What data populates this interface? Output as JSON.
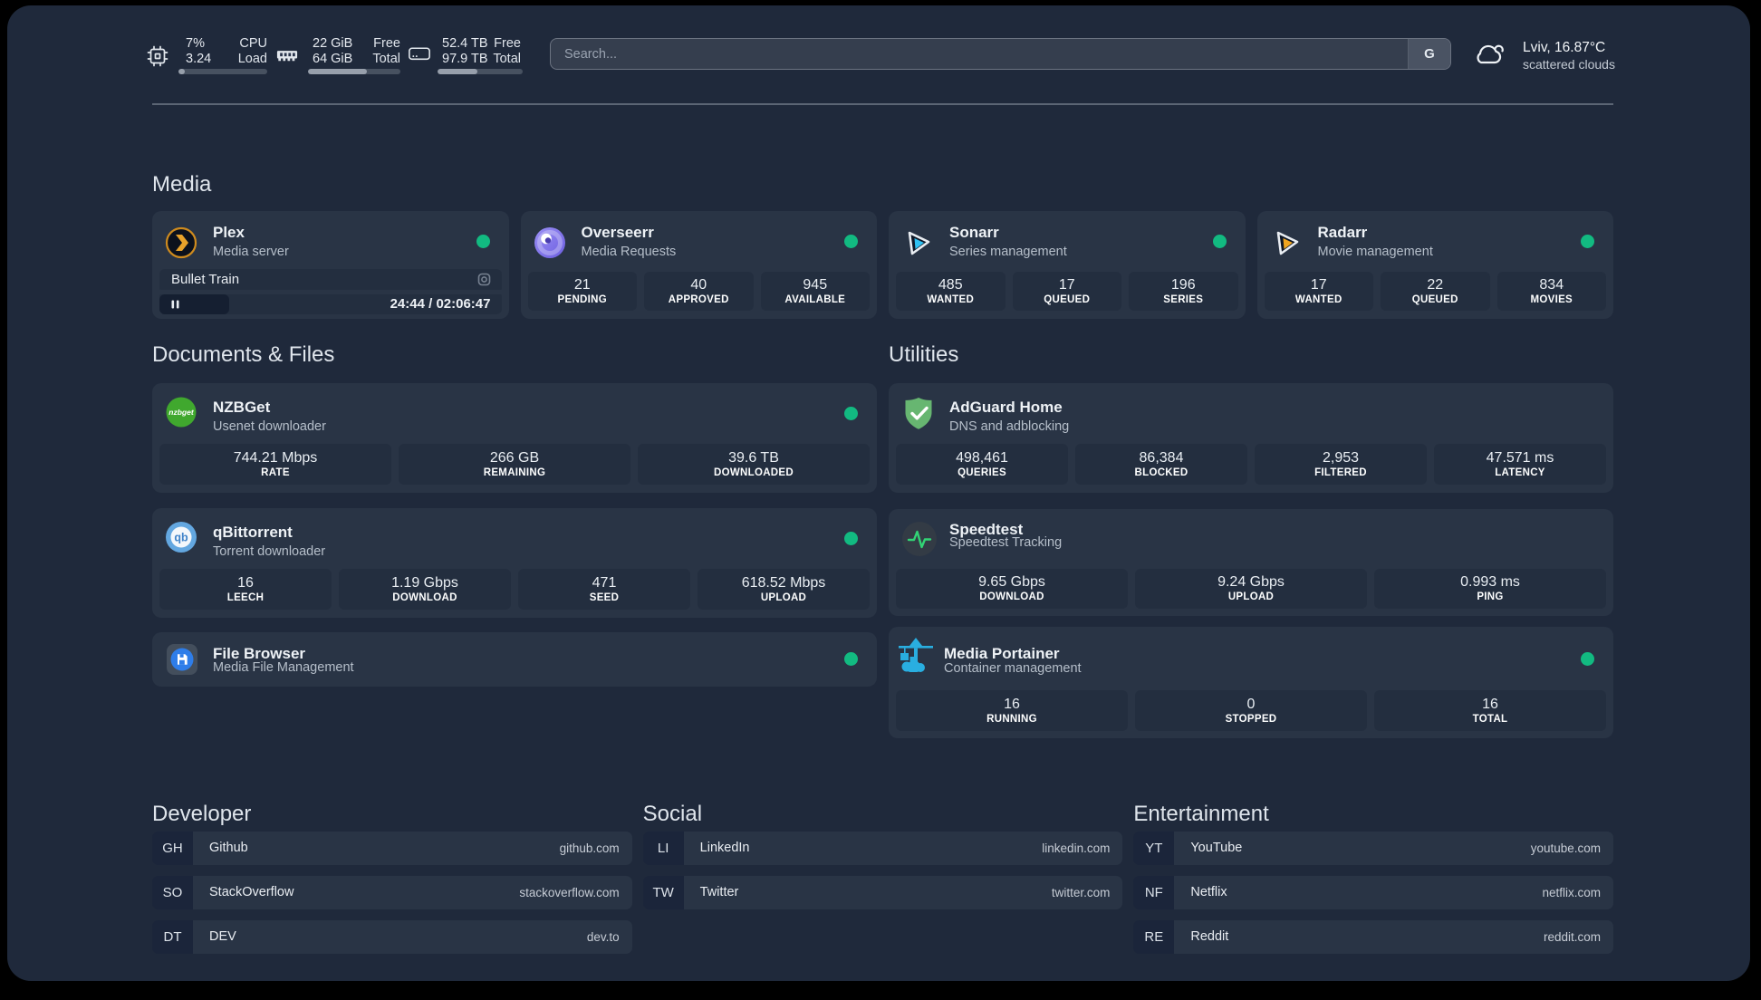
{
  "topbar": {
    "resources": [
      {
        "icon": "cpu-icon",
        "values": [
          "7%",
          "3.24"
        ],
        "labels": [
          "CPU",
          "Load"
        ],
        "percent": 7
      },
      {
        "icon": "ram-icon",
        "values": [
          "22 GiB",
          "64 GiB"
        ],
        "labels": [
          "Free",
          "Total"
        ],
        "percent": 64
      },
      {
        "icon": "disk-icon",
        "values": [
          "52.4 TB",
          "97.9 TB"
        ],
        "labels": [
          "Free",
          "Total"
        ],
        "percent": 47
      }
    ],
    "search": {
      "placeholder": "Search...",
      "button": "G"
    },
    "weather": {
      "location_temp": "Lviv, 16.87°C",
      "condition": "scattered clouds"
    }
  },
  "sections": {
    "media": {
      "title": "Media",
      "cards": {
        "plex": {
          "name": "Plex",
          "desc": "Media server",
          "media": {
            "track": "Bullet Train",
            "time": "24:44 / 02:06:47"
          }
        },
        "overseerr": {
          "name": "Overseerr",
          "desc": "Media Requests",
          "stats": [
            {
              "value": "21",
              "label": "PENDING"
            },
            {
              "value": "40",
              "label": "APPROVED"
            },
            {
              "value": "945",
              "label": "AVAILABLE"
            }
          ]
        },
        "sonarr": {
          "name": "Sonarr",
          "desc": "Series management",
          "stats": [
            {
              "value": "485",
              "label": "WANTED"
            },
            {
              "value": "17",
              "label": "QUEUED"
            },
            {
              "value": "196",
              "label": "SERIES"
            }
          ]
        },
        "radarr": {
          "name": "Radarr",
          "desc": "Movie management",
          "stats": [
            {
              "value": "17",
              "label": "WANTED"
            },
            {
              "value": "22",
              "label": "QUEUED"
            },
            {
              "value": "834",
              "label": "MOVIES"
            }
          ]
        }
      }
    },
    "documents": {
      "title": "Documents & Files",
      "cards": {
        "nzbget": {
          "name": "NZBGet",
          "desc": "Usenet downloader",
          "stats": [
            {
              "value": "744.21 Mbps",
              "label": "RATE"
            },
            {
              "value": "266 GB",
              "label": "REMAINING"
            },
            {
              "value": "39.6 TB",
              "label": "DOWNLOADED"
            }
          ]
        },
        "qbittorrent": {
          "name": "qBittorrent",
          "desc": "Torrent downloader",
          "stats": [
            {
              "value": "16",
              "label": "LEECH"
            },
            {
              "value": "1.19 Gbps",
              "label": "DOWNLOAD"
            },
            {
              "value": "471",
              "label": "SEED"
            },
            {
              "value": "618.52 Mbps",
              "label": "UPLOAD"
            }
          ]
        },
        "filebrowser": {
          "name": "File Browser",
          "desc": "Media File Management"
        }
      }
    },
    "utilities": {
      "title": "Utilities",
      "cards": {
        "adguard": {
          "name": "AdGuard Home",
          "desc": "DNS and adblocking",
          "stats": [
            {
              "value": "498,461",
              "label": "QUERIES"
            },
            {
              "value": "86,384",
              "label": "BLOCKED"
            },
            {
              "value": "2,953",
              "label": "FILTERED"
            },
            {
              "value": "47.571 ms",
              "label": "LATENCY"
            }
          ]
        },
        "speedtest": {
          "name": "Speedtest",
          "desc": "Speedtest Tracking",
          "stats": [
            {
              "value": "9.65 Gbps",
              "label": "DOWNLOAD"
            },
            {
              "value": "9.24 Gbps",
              "label": "UPLOAD"
            },
            {
              "value": "0.993 ms",
              "label": "PING"
            }
          ]
        },
        "portainer": {
          "name": "Media Portainer",
          "desc": "Container management",
          "stats": [
            {
              "value": "16",
              "label": "RUNNING"
            },
            {
              "value": "0",
              "label": "STOPPED"
            },
            {
              "value": "16",
              "label": "TOTAL"
            }
          ]
        }
      }
    }
  },
  "bookmarks": {
    "developer": {
      "title": "Developer",
      "items": [
        {
          "abbr": "GH",
          "name": "Github",
          "url": "github.com"
        },
        {
          "abbr": "SO",
          "name": "StackOverflow",
          "url": "stackoverflow.com"
        },
        {
          "abbr": "DT",
          "name": "DEV",
          "url": "dev.to"
        }
      ]
    },
    "social": {
      "title": "Social",
      "items": [
        {
          "abbr": "LI",
          "name": "LinkedIn",
          "url": "linkedin.com"
        },
        {
          "abbr": "TW",
          "name": "Twitter",
          "url": "twitter.com"
        }
      ]
    },
    "entertainment": {
      "title": "Entertainment",
      "items": [
        {
          "abbr": "YT",
          "name": "YouTube",
          "url": "youtube.com"
        },
        {
          "abbr": "NF",
          "name": "Netflix",
          "url": "netflix.com"
        },
        {
          "abbr": "RE",
          "name": "Reddit",
          "url": "reddit.com"
        }
      ]
    }
  },
  "colors": {
    "status_green": "#12ba81",
    "accent_blue": "#29aee0"
  }
}
